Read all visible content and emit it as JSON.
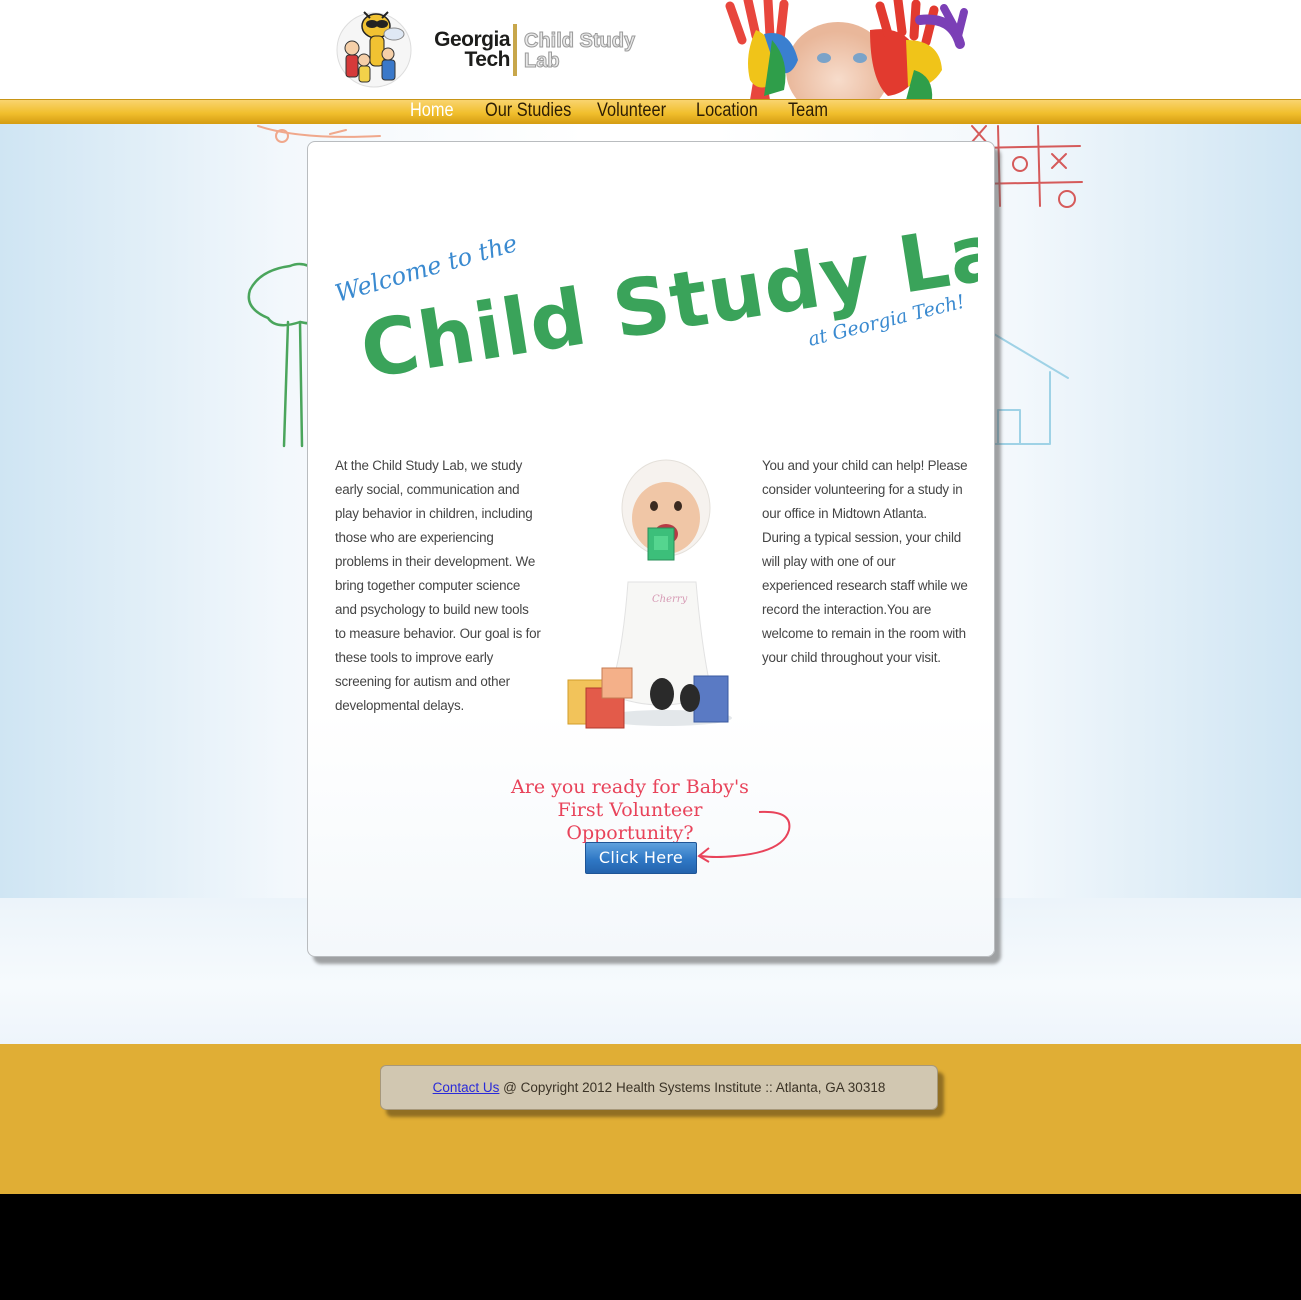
{
  "header": {
    "logo_line1": "Georgia",
    "logo_line2": "Tech",
    "logo_lab_line1": "Child Study",
    "logo_lab_line2": "Lab"
  },
  "nav": {
    "items": [
      {
        "label": "Home",
        "active": true
      },
      {
        "label": "Our Studies",
        "active": false
      },
      {
        "label": "Volunteer",
        "active": false
      },
      {
        "label": "Location",
        "active": false
      },
      {
        "label": "Team",
        "active": false
      }
    ]
  },
  "hero": {
    "welcome": "Welcome to the",
    "title": "Child Study Lab",
    "subtitle": "at Georgia Tech!"
  },
  "intro": {
    "left_paragraph": "At the Child Study Lab, we study early social, communication and play behavior in children, including those who are experiencing problems in their development. We bring together computer science and psychology to build new tools to measure behavior. Our goal is for these tools to improve early screening for autism and other developmental delays.",
    "right_paragraph": "You and your child can help! Please consider volunteering for a study in our office in Midtown Atlanta. During a typical session, your child will play with one of our experienced research staff while we record the interaction.You are welcome to remain in the room with your child throughout your visit.",
    "baby_shirt_text": "Cherry"
  },
  "cta": {
    "line1": "Are you ready for Baby's",
    "line2": "First Volunteer Opportunity?",
    "button_label": "Click Here"
  },
  "footer": {
    "contact_link": "Contact Us",
    "copyright": " @ Copyright 2012 Health Systems Institute :: Atlanta, GA 30318"
  },
  "colors": {
    "nav_gold": "#f1bf2d",
    "title_green": "#3aa35a",
    "accent_blue": "#3a8ad0",
    "cta_red": "#e8435a",
    "footer_gold": "#e0ae35"
  }
}
